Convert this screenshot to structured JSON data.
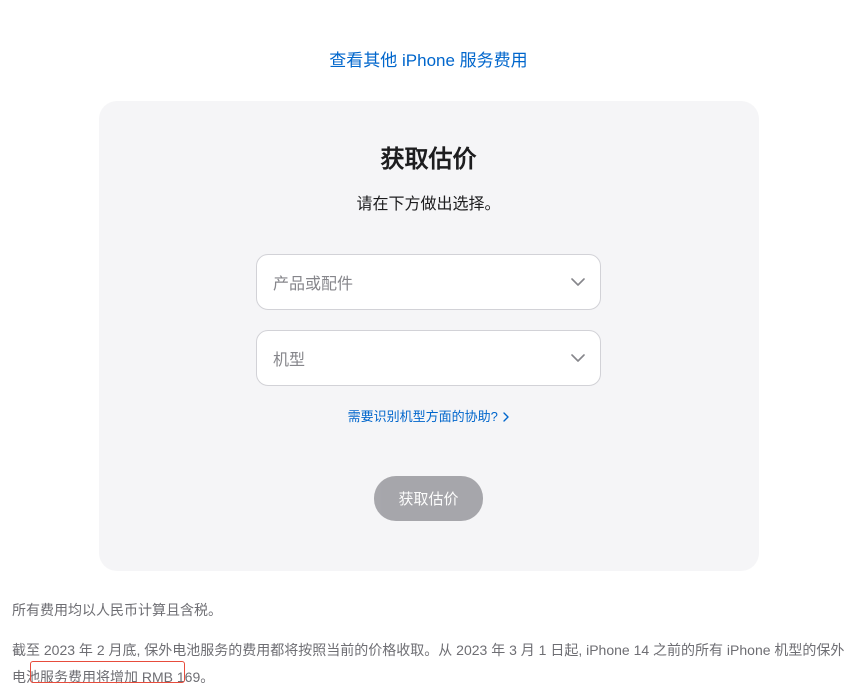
{
  "topLink": "查看其他 iPhone 服务费用",
  "card": {
    "title": "获取估价",
    "subtitle": "请在下方做出选择。",
    "productSelect": "产品或配件",
    "modelSelect": "机型",
    "helpLink": "需要识别机型方面的协助?",
    "submitButton": "获取估价"
  },
  "footer": {
    "line1": "所有费用均以人民币计算且含税。",
    "paragraph": "截至 2023 年 2 月底, 保外电池服务的费用都将按照当前的价格收取。从 2023 年 3 月 1 日起, iPhone 14 之前的所有 iPhone 机型的保外电池服务费用将增加 RMB 169。"
  }
}
